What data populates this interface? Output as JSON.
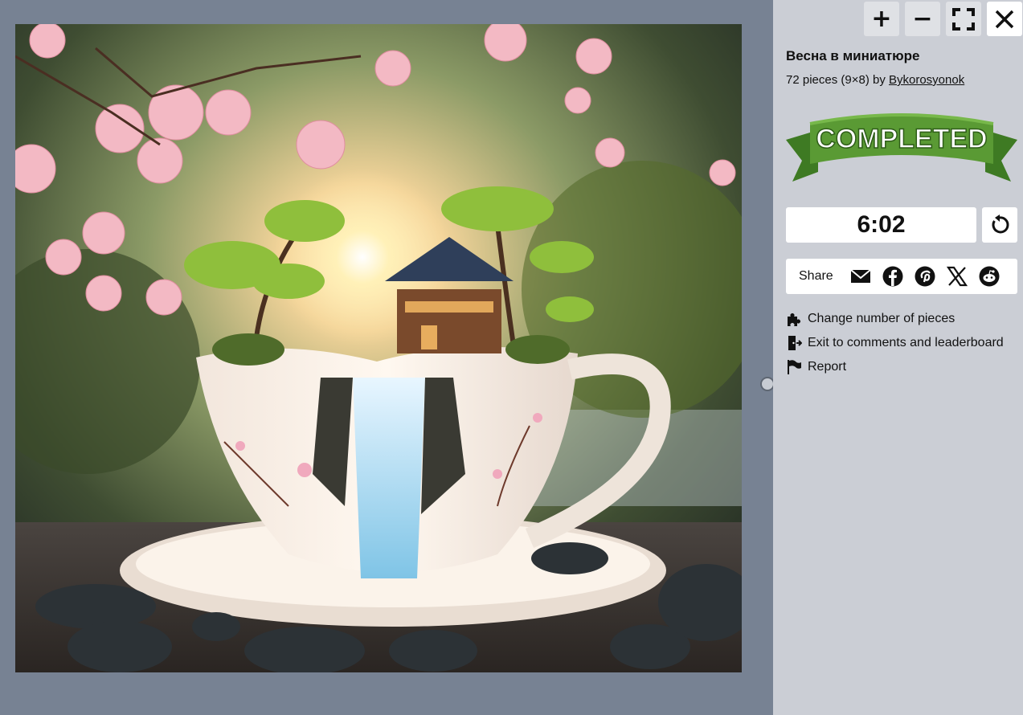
{
  "toolbar": {
    "zoom_in": "+",
    "zoom_out": "−"
  },
  "puzzle": {
    "title": "Весна в миниатюре",
    "info": "72 pieces (9×8) by ",
    "author": "Bykorosyonok",
    "status": "COMPLETED"
  },
  "timer": {
    "value": "6:02"
  },
  "share": {
    "label": "Share",
    "icons": [
      "mail-icon",
      "facebook-icon",
      "pinterest-icon",
      "x-icon",
      "reddit-icon"
    ]
  },
  "menu": {
    "change_pieces": "Change number of pieces",
    "exit_comments": "Exit to comments and leaderboard",
    "report": "Report"
  },
  "colors": {
    "canvas_bg": "#778293",
    "sidebar_bg": "#cbced5",
    "banner_green": "#5a9a34",
    "banner_dark": "#3e7a23"
  }
}
